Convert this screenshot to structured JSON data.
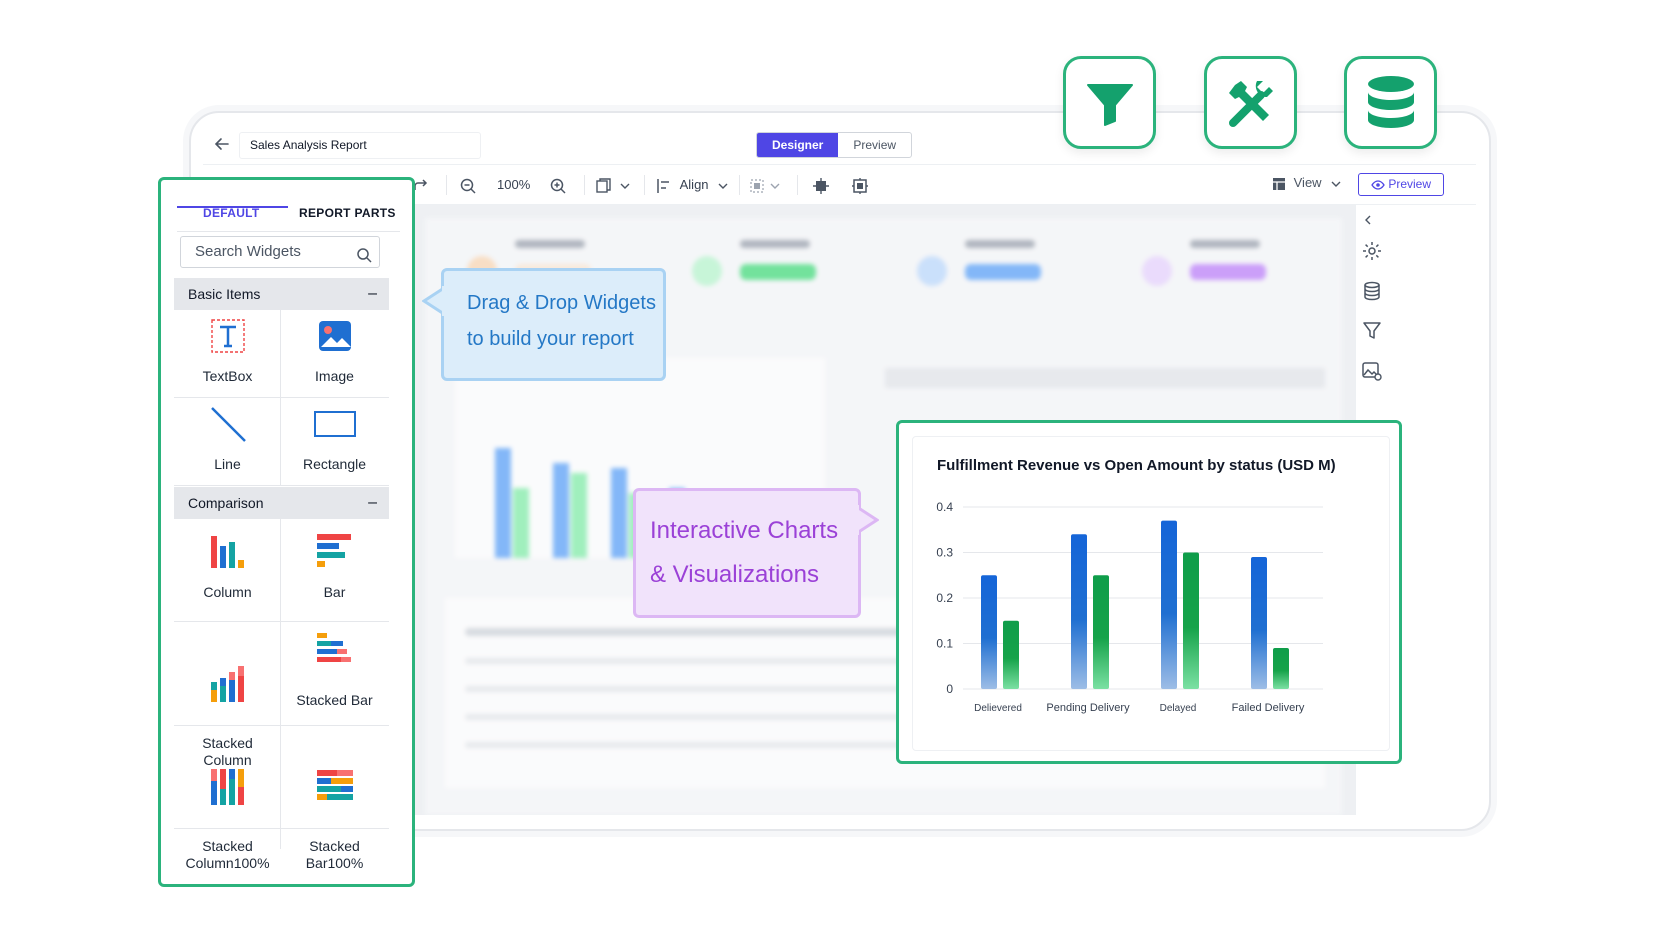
{
  "topbar": {
    "report_title": "Sales Analysis Report",
    "designer_tab": "Designer",
    "preview_tab": "Preview"
  },
  "toolbar": {
    "zoom": "100%",
    "align_label": "Align",
    "view_label": "View",
    "preview_button": "Preview"
  },
  "widget_panel": {
    "tabs": [
      "DEFAULT",
      "REPORT PARTS"
    ],
    "search_placeholder": "Search Widgets",
    "groups": [
      {
        "title": "Basic Items",
        "items": [
          "TextBox",
          "Image",
          "Line",
          "Rectangle"
        ]
      },
      {
        "title": "Comparison",
        "items": [
          "Column",
          "Bar",
          "Stacked\nColumn",
          "Stacked Bar",
          "Stacked\nColumn100%",
          "Stacked\nBar100%"
        ]
      }
    ]
  },
  "callouts": {
    "drag_drop": [
      "Drag & Drop Widgets",
      "to build your report"
    ],
    "interactive": [
      "Interactive Charts",
      "& Visualizations"
    ]
  },
  "feature_icons": [
    "filter-icon",
    "tools-icon",
    "database-icon"
  ],
  "colors": {
    "accent": "#4f46e5",
    "highlight_green": "#2bb37c",
    "series_blue": "#1f6fd1",
    "series_green": "#17a34a"
  },
  "chart_data": {
    "type": "bar",
    "title": "Fulfillment Revenue vs Open Amount by status (USD M)",
    "categories": [
      "Delievered",
      "Pending Delivery",
      "Delayed",
      "Failed Delivery"
    ],
    "series": [
      {
        "values": [
          0.25,
          0.34,
          0.37,
          0.29
        ]
      },
      {
        "values": [
          0.15,
          0.25,
          0.3,
          0.09
        ]
      }
    ],
    "yticks": [
      "0",
      "0.1",
      "0.2",
      "0.3",
      "0.4"
    ],
    "ylim": [
      0,
      0.4
    ],
    "grid": true
  }
}
